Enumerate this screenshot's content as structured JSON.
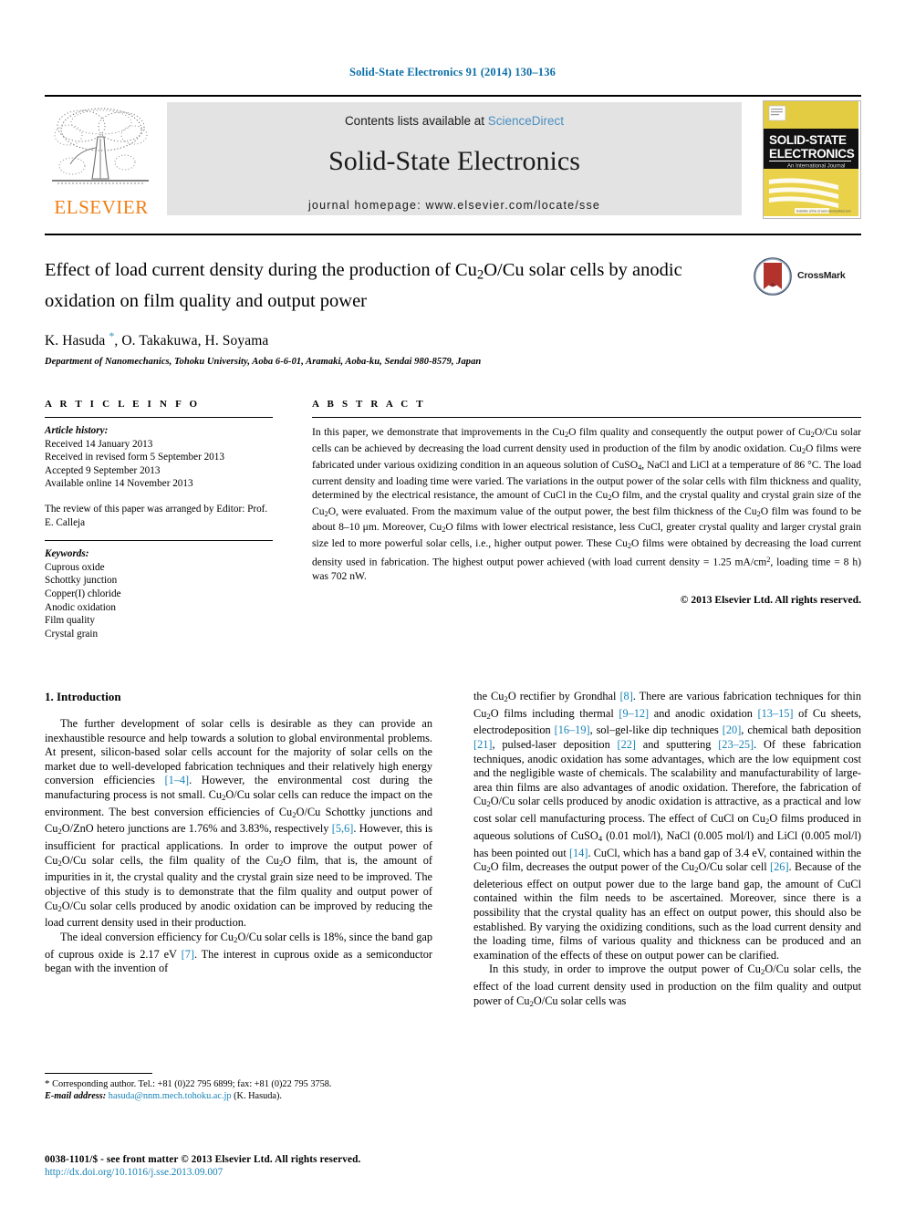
{
  "running_head": "Solid-State Electronics 91 (2014) 130–136",
  "masthead": {
    "publisher_name": "ELSEVIER",
    "contents_prefix": "Contents lists available at ",
    "sciencedirect": "ScienceDirect",
    "journal_title": "Solid-State Electronics",
    "homepage": "journal homepage: www.elsevier.com/locate/sse",
    "cover": {
      "line1": "SOLID-STATE",
      "line2": "ELECTRONICS",
      "tagline": "An International Journal",
      "footer_text": "Available online at www.sciencedirect.com"
    }
  },
  "article": {
    "title": "Effect of load current density during the production of Cu2O/Cu solar cells by anodic oxidation on film quality and output power",
    "title_html": "Effect of load current density during the production of Cu<sub>2</sub>O/Cu solar cells by anodic oxidation on film quality and output power",
    "crossmark_label": "CrossMark",
    "authors": "K. Hasuda *, O. Takakuwa, H. Soyama",
    "affiliation": "Department of Nanomechanics, Tohoku University, Aoba 6-6-01, Aramaki, Aoba-ku, Sendai 980-8579, Japan"
  },
  "article_info": {
    "heading": "A R T I C L E   I N F O",
    "history_label": "Article history:",
    "history": [
      "Received 14 January 2013",
      "Received in revised form 5 September 2013",
      "Accepted 9 September 2013",
      "Available online 14 November 2013"
    ],
    "editor_note": "The review of this paper was arranged by Editor: Prof. E. Calleja",
    "keywords_label": "Keywords:",
    "keywords": [
      "Cuprous oxide",
      "Schottky junction",
      "Copper(I) chloride",
      "Anodic oxidation",
      "Film quality",
      "Crystal grain"
    ]
  },
  "abstract": {
    "heading": "A B S T R A C T",
    "text_html": "In this paper, we demonstrate that improvements in the Cu<sub>2</sub>O film quality and consequently the output power of Cu<sub>2</sub>O/Cu solar cells can be achieved by decreasing the load current density used in production of the film by anodic oxidation. Cu<sub>2</sub>O films were fabricated under various oxidizing condition in an aqueous solution of CuSO<sub>4</sub>, NaCl and LiCl at a temperature of 86 &deg;C. The load current density and loading time were varied. The variations in the output power of the solar cells with film thickness and quality, determined by the electrical resistance, the amount of CuCl in the Cu<sub>2</sub>O film, and the crystal quality and crystal grain size of the Cu<sub>2</sub>O, were evaluated. From the maximum value of the output power, the best film thickness of the Cu<sub>2</sub>O film was found to be about 8&ndash;10 &mu;m. Moreover, Cu<sub>2</sub>O films with lower electrical resistance, less CuCl, greater crystal quality and larger crystal grain size led to more powerful solar cells, i.e., higher output power. These Cu<sub>2</sub>O films were obtained by decreasing the load current density used in fabrication. The highest output power achieved (with load current density = 1.25 mA/cm<sup>2</sup>, loading time = 8 h) was 702 nW.",
    "copyright": "© 2013 Elsevier Ltd. All rights reserved."
  },
  "introduction": {
    "heading": "1. Introduction",
    "left_paragraphs_html": [
      "The further development of solar cells is desirable as they can provide an inexhaustible resource and help towards a solution to global environmental problems. At present, silicon-based solar cells account for the majority of solar cells on the market due to well-developed fabrication techniques and their relatively high energy conversion efficiencies <span class=\"ref\">[1&ndash;4]</span>. However, the environmental cost during the manufacturing process is not small. Cu<sub>2</sub>O/Cu solar cells can reduce the impact on the environment. The best conversion efficiencies of Cu<sub>2</sub>O/Cu Schottky junctions and Cu<sub>2</sub>O/ZnO hetero junctions are 1.76% and 3.83%, respectively <span class=\"ref\">[5,6]</span>. However, this is insufficient for practical applications. In order to improve the output power of Cu<sub>2</sub>O/Cu solar cells, the film quality of the Cu<sub>2</sub>O film, that is, the amount of impurities in it, the crystal quality and the crystal grain size need to be improved. The objective of this study is to demonstrate that the film quality and output power of Cu<sub>2</sub>O/Cu solar cells produced by anodic oxidation can be improved by reducing the load current density used in their production.",
      "The ideal conversion efficiency for Cu<sub>2</sub>O/Cu solar cells is 18%, since the band gap of cuprous oxide is 2.17 eV <span class=\"ref\">[7]</span>. The interest in cuprous oxide as a semiconductor began with the invention of"
    ],
    "right_paragraphs_html": [
      "the Cu<sub>2</sub>O rectifier by Grondhal <span class=\"ref\">[8]</span>. There are various fabrication techniques for thin Cu<sub>2</sub>O films including thermal <span class=\"ref\">[9&ndash;12]</span> and anodic oxidation <span class=\"ref\">[13&ndash;15]</span> of Cu sheets, electrodeposition <span class=\"ref\">[16&ndash;19]</span>, sol&ndash;gel-like dip techniques <span class=\"ref\">[20]</span>, chemical bath deposition <span class=\"ref\">[21]</span>, pulsed-laser deposition <span class=\"ref\">[22]</span> and sputtering <span class=\"ref\">[23&ndash;25]</span>. Of these fabrication techniques, anodic oxidation has some advantages, which are the low equipment cost and the negligible waste of chemicals. The scalability and manufacturability of large-area thin films are also advantages of anodic oxidation. Therefore, the fabrication of Cu<sub>2</sub>O/Cu solar cells produced by anodic oxidation is attractive, as a practical and low cost solar cell manufacturing process. The effect of CuCl on Cu<sub>2</sub>O films produced in aqueous solutions of CuSO<sub>4</sub> (0.01 mol/l), NaCl (0.005 mol/l) and LiCl (0.005 mol/l) has been pointed out <span class=\"ref\">[14]</span>. CuCl, which has a band gap of 3.4 eV, contained within the Cu<sub>2</sub>O film, decreases the output power of the Cu<sub>2</sub>O/Cu solar cell <span class=\"ref\">[26]</span>. Because of the deleterious effect on output power due to the large band gap, the amount of CuCl contained within the film needs to be ascertained. Moreover, since there is a possibility that the crystal quality has an effect on output power, this should also be established. By varying the oxidizing conditions, such as the load current density and the loading time, films of various quality and thickness can be produced and an examination of the effects of these on output power can be clarified.",
      "In this study, in order to improve the output power of Cu<sub>2</sub>O/Cu solar cells, the effect of the load current density used in production on the film quality and output power of Cu<sub>2</sub>O/Cu solar cells was"
    ]
  },
  "footnote": {
    "corresponding_html": "<span class=\"star\">*</span> Corresponding author. Tel.: +81 (0)22 795 6899; fax: +81 (0)22 795 3758.",
    "email_label": "E-mail address:",
    "email": "hasuda@nnm.mech.tohoku.ac.jp",
    "email_owner": "(K. Hasuda)."
  },
  "footer": {
    "issn_line": "0038-1101/$ - see front matter © 2013 Elsevier Ltd. All rights reserved.",
    "doi": "http://dx.doi.org/10.1016/j.sse.2013.09.007"
  },
  "colors": {
    "link_blue": "#1782b8",
    "running_head_blue": "#0b6ea8",
    "sciencedirect_blue": "#4a8fc0",
    "elsevier_orange": "#F07E13",
    "masthead_gray": "#e3e3e3",
    "cover_yellow": "#e8c93c",
    "crossmark_red": "#b1332b"
  }
}
